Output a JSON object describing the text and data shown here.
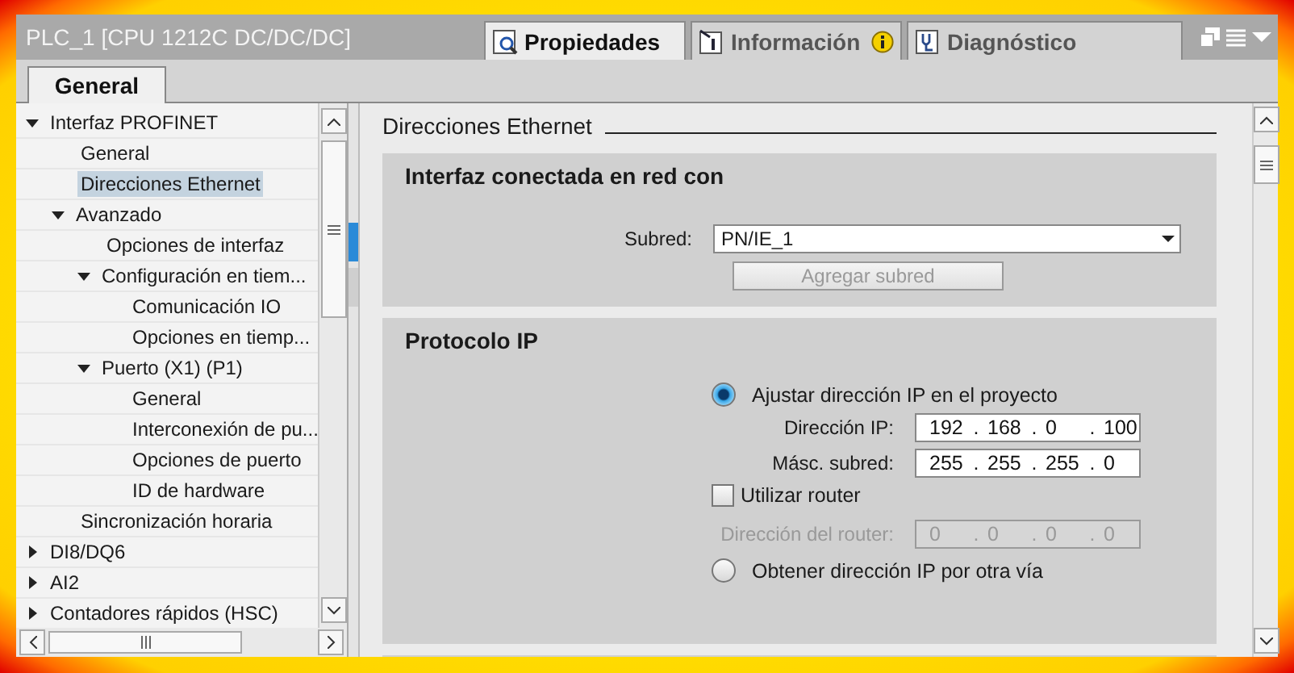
{
  "window": {
    "title": "PLC_1 [CPU 1212C DC/DC/DC]"
  },
  "header_tabs": [
    {
      "label": "Propiedades",
      "selected": true,
      "kind": "properties",
      "badge": false
    },
    {
      "label": "Información",
      "selected": false,
      "kind": "info",
      "badge": true
    },
    {
      "label": "Diagnóstico",
      "selected": false,
      "kind": "diagnostics",
      "badge": false
    }
  ],
  "sub_tabs": [
    {
      "label": "General",
      "selected": true
    }
  ],
  "tree": [
    {
      "label": "Interfaz PROFINET",
      "selected": false,
      "expanded": true,
      "children": [
        {
          "label": "General",
          "selected": false
        },
        {
          "label": "Direcciones Ethernet",
          "selected": true
        },
        {
          "label": "Avanzado",
          "selected": false,
          "expanded": true,
          "children": [
            {
              "label": "Opciones de interfaz",
              "selected": false
            },
            {
              "label": "Configuración en tiem...",
              "selected": false,
              "expanded": true,
              "children": [
                {
                  "label": "Comunicación IO",
                  "selected": false
                },
                {
                  "label": "Opciones en tiemp...",
                  "selected": false
                }
              ]
            },
            {
              "label": "Puerto (X1) (P1)",
              "selected": false,
              "expanded": true,
              "children": [
                {
                  "label": "General",
                  "selected": false
                },
                {
                  "label": "Interconexión de pu...",
                  "selected": false
                },
                {
                  "label": "Opciones de puerto",
                  "selected": false
                },
                {
                  "label": "ID de hardware",
                  "selected": false
                }
              ]
            }
          ]
        },
        {
          "label": "Sincronización horaria",
          "selected": false
        }
      ]
    },
    {
      "label": "DI8/DQ6",
      "selected": false,
      "expanded": false
    },
    {
      "label": "AI2",
      "selected": false,
      "expanded": false
    },
    {
      "label": "Contadores rápidos (HSC)",
      "selected": false,
      "expanded": false
    }
  ],
  "page_heading": "Direcciones Ethernet",
  "network_section": {
    "title": "Interfaz conectada en red con",
    "subnet_label": "Subred:",
    "subnet_value": "PN/IE_1",
    "add_subnet_button": {
      "label": "Agregar subred",
      "disabled": true
    }
  },
  "ip_section": {
    "title": "Protocolo IP",
    "set_in_project": {
      "label": "Ajustar dirección IP en el proyecto",
      "selected": true
    },
    "ip_address": {
      "label": "Dirección IP:",
      "parts": [
        "192",
        ".",
        "168",
        ".",
        "0",
        ".",
        "100"
      ],
      "disabled": false
    },
    "subnet_mask": {
      "label": "Másc. subred:",
      "parts": [
        "255",
        ".",
        "255",
        ".",
        "255",
        ".",
        "0"
      ],
      "disabled": false
    },
    "use_router": {
      "label": "Utilizar router",
      "checked": false
    },
    "router_address": {
      "label": "Dirección del router:",
      "parts": [
        "0",
        ".",
        "0",
        ".",
        "0",
        ".",
        "0"
      ],
      "disabled": true
    },
    "other_way": {
      "label": "Obtener dirección IP por otra vía",
      "selected": false
    }
  }
}
